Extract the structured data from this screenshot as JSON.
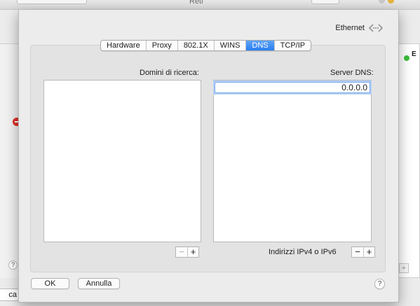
{
  "background": {
    "window_title": "Reti",
    "right_entry_initial": "E",
    "left_partial_button": "ca"
  },
  "sheet": {
    "interface_name": "Ethernet",
    "interface_icon": "ethernet-arrows-icon",
    "tabs": [
      {
        "label": "Hardware",
        "active": false
      },
      {
        "label": "Proxy",
        "active": false
      },
      {
        "label": "802.1X",
        "active": false
      },
      {
        "label": "WINS",
        "active": false
      },
      {
        "label": "DNS",
        "active": true
      },
      {
        "label": "TCP/IP",
        "active": false
      }
    ],
    "search_domains": {
      "label": "Domini di ricerca:",
      "entries": []
    },
    "dns_servers": {
      "label": "Server DNS:",
      "entries": [
        "0.0.0.0"
      ],
      "hint": "Indirizzi IPv4 o IPv6"
    },
    "buttons": {
      "ok": "OK",
      "cancel": "Annulla",
      "add": "+",
      "remove": "−",
      "help": "?"
    }
  },
  "colors": {
    "accent": "#2a7ef0",
    "status_green": "#3bbf3b",
    "status_red": "#e0322b"
  }
}
